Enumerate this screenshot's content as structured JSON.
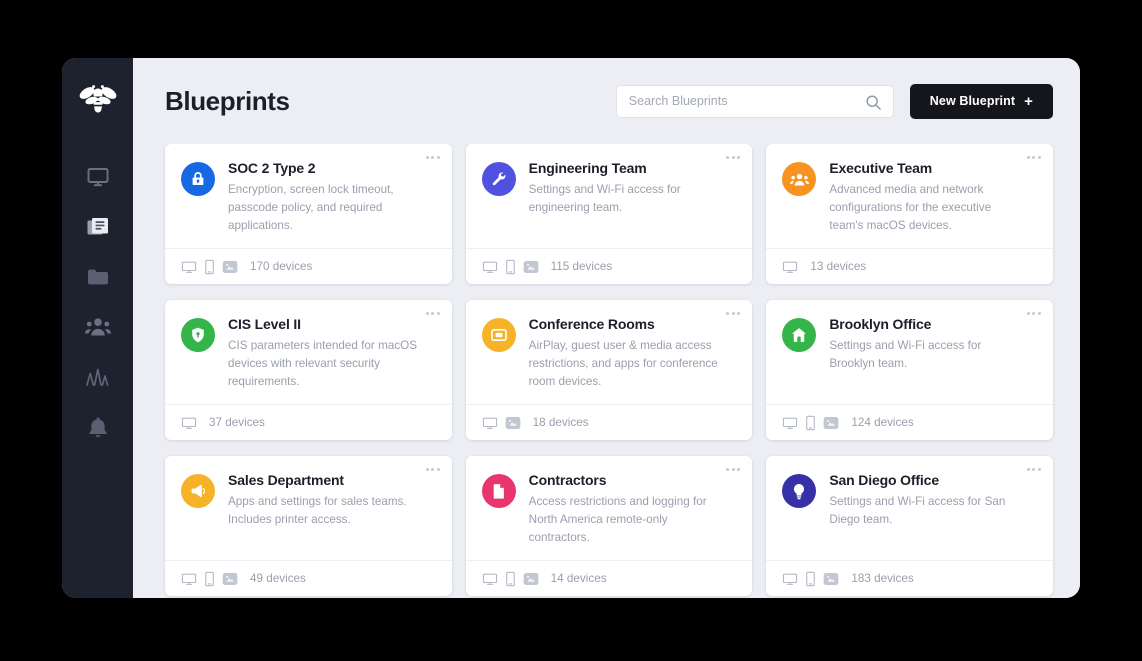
{
  "app": {
    "logo_icon": "bee-logo-icon",
    "sidebar_bg": "#1e222e",
    "content_bg": "#eceef4"
  },
  "sidebar": {
    "items": [
      {
        "icon": "monitor-icon",
        "name": "devices"
      },
      {
        "icon": "blueprint-icon",
        "name": "blueprints"
      },
      {
        "icon": "folder-icon",
        "name": "library"
      },
      {
        "icon": "users-icon",
        "name": "users"
      },
      {
        "icon": "analytics-icon",
        "name": "activity"
      },
      {
        "icon": "bell-icon",
        "name": "alerts"
      }
    ]
  },
  "header": {
    "title": "Blueprints"
  },
  "search": {
    "placeholder": "Search Blueprints",
    "value": "",
    "icon": "search-icon"
  },
  "actions": {
    "new_blueprint_label": "New Blueprint",
    "new_blueprint_plus": "+"
  },
  "cards": [
    {
      "title": "SOC 2 Type 2",
      "description": "Encryption, screen lock timeout, passcode policy, and required applications.",
      "icon": "lock-icon",
      "icon_color": "#1669e3",
      "devices_label": "170 devices",
      "device_icons": [
        "monitor-icon",
        "phone-icon",
        "tv-icon"
      ]
    },
    {
      "title": "Engineering Team",
      "description": "Settings and Wi-Fi access for engineering team.",
      "icon": "wrench-icon",
      "icon_color": "#5151e0",
      "devices_label": "115 devices",
      "device_icons": [
        "monitor-icon",
        "phone-icon",
        "tv-icon"
      ]
    },
    {
      "title": "Executive Team",
      "description": "Advanced media and network configurations for the executive team's macOS devices.",
      "icon": "users-icon",
      "icon_color": "#f7931e",
      "devices_label": "13 devices",
      "device_icons": [
        "monitor-icon"
      ]
    },
    {
      "title": "CIS Level II",
      "description": "CIS parameters intended for macOS devices with relevant security requirements.",
      "icon": "shield-icon",
      "icon_color": "#35b44a",
      "devices_label": "37 devices",
      "device_icons": [
        "monitor-icon"
      ]
    },
    {
      "title": "Conference Rooms",
      "description": "AirPlay, guest user & media access restrictions, and apps for conference room devices.",
      "icon": "display-icon",
      "icon_color": "#f7b328",
      "devices_label": "18 devices",
      "device_icons": [
        "monitor-icon",
        "tv-icon"
      ]
    },
    {
      "title": "Brooklyn Office",
      "description": "Settings and Wi-Fi access for Brooklyn team.",
      "icon": "home-icon",
      "icon_color": "#35b44a",
      "devices_label": "124 devices",
      "device_icons": [
        "monitor-icon",
        "phone-icon",
        "tv-icon"
      ]
    },
    {
      "title": "Sales Department",
      "description": "Apps and settings for sales teams. Includes printer access.",
      "icon": "megaphone-icon",
      "icon_color": "#f7b328",
      "devices_label": "49 devices",
      "device_icons": [
        "monitor-icon",
        "phone-icon",
        "tv-icon"
      ]
    },
    {
      "title": "Contractors",
      "description": "Access restrictions and logging for North America remote-only contractors.",
      "icon": "document-icon",
      "icon_color": "#e8356d",
      "devices_label": "14 devices",
      "device_icons": [
        "monitor-icon",
        "phone-icon",
        "tv-icon"
      ]
    },
    {
      "title": "San Diego Office",
      "description": "Settings and Wi-Fi access for San Diego team.",
      "icon": "lightbulb-icon",
      "icon_color": "#3731a8",
      "devices_label": "183 devices",
      "device_icons": [
        "monitor-icon",
        "phone-icon",
        "tv-icon"
      ]
    }
  ]
}
